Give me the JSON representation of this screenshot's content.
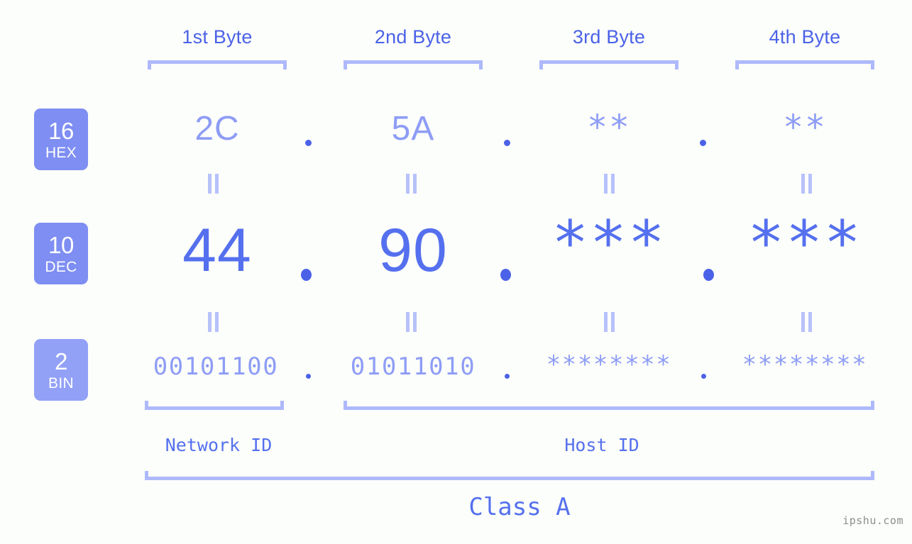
{
  "accent": {
    "strong": "#4b62e8",
    "mid": "#5570ee",
    "light": "#8e9df5",
    "pale": "#aeb9fb",
    "badge_bg": "#7e8ef2",
    "badge_bg_light": "#92a1f6",
    "background": "#fcfefb"
  },
  "byte_headers": [
    {
      "label": "1st Byte"
    },
    {
      "label": "2nd Byte"
    },
    {
      "label": "3rd Byte"
    },
    {
      "label": "4th Byte"
    }
  ],
  "bases": [
    {
      "number": "16",
      "abbr": "HEX"
    },
    {
      "number": "10",
      "abbr": "DEC"
    },
    {
      "number": "2",
      "abbr": "BIN"
    }
  ],
  "rows": {
    "hex": {
      "base": "16",
      "name": "HEX",
      "values": [
        "2C",
        "5A",
        "**",
        "**"
      ]
    },
    "dec": {
      "base": "10",
      "name": "DEC",
      "values": [
        "44",
        "90",
        "***",
        "***"
      ]
    },
    "bin": {
      "base": "2",
      "name": "BIN",
      "values": [
        "00101100",
        "01011010",
        "********",
        "********"
      ]
    }
  },
  "separator": ".",
  "segments": {
    "network_id": "Network ID",
    "host_id": "Host ID",
    "class": "Class A"
  },
  "watermark": "ipshu.com"
}
